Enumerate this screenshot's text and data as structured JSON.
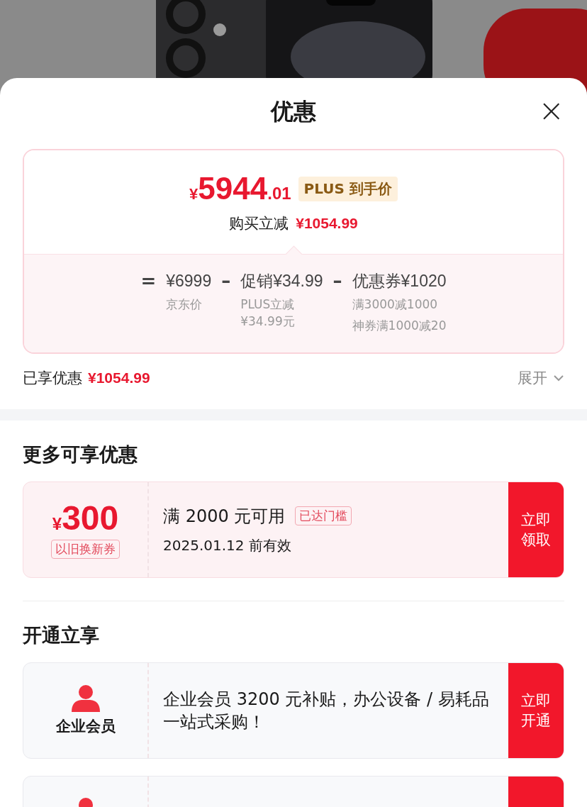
{
  "header": {
    "title": "优惠",
    "close": "×"
  },
  "price_card": {
    "final_price": {
      "currency": "¥",
      "integer": "5944",
      "decimal": ".01"
    },
    "badge": "PLUS 到手价",
    "reduction": {
      "label": "购买立减",
      "amount": "¥1054.99"
    },
    "formula": [
      {
        "kind": "op",
        "text": "="
      },
      {
        "kind": "term",
        "text": "¥6999",
        "notes": [
          "京东价"
        ]
      },
      {
        "kind": "op",
        "text": "–"
      },
      {
        "kind": "term",
        "text": "促销¥34.99",
        "notes": [
          "PLUS立减¥34.99元"
        ]
      },
      {
        "kind": "op",
        "text": "–"
      },
      {
        "kind": "term",
        "text": "优惠券¥1020",
        "notes": [
          "满3000减1000",
          "神券满1000减20"
        ]
      }
    ]
  },
  "summary": {
    "label": "已享优惠",
    "amount": "¥1054.99",
    "expand": "展开"
  },
  "sections": [
    {
      "title": "更多可享优惠",
      "cards": [
        {
          "kind": "coupon",
          "currency": "¥",
          "amount": "300",
          "tag": "以旧换新券",
          "condition": "满 2000 元可用",
          "badge": "已达门槛",
          "validity": "2025.01.12 前有效",
          "action": "立即领取"
        }
      ]
    },
    {
      "title": "开通立享",
      "cards": [
        {
          "kind": "membership",
          "name": "企业会员",
          "description": "企业会员 3200 元补贴，办公设备 / 易耗品一站式采购！",
          "action": "立即开通"
        },
        {
          "kind": "membership"
        }
      ]
    }
  ]
}
